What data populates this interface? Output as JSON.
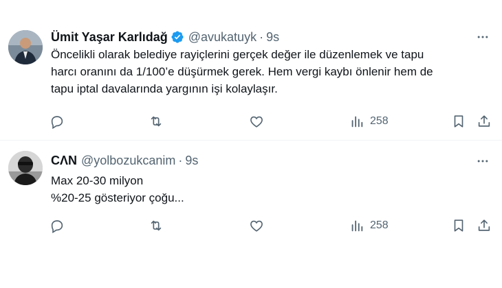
{
  "tweets": [
    {
      "author_name": "Ümit Yaşar Karlıdağ",
      "verified": true,
      "handle": "@avukatuyk",
      "separator": "·",
      "time": "9s",
      "text_lines": [
        "Öncelikli olarak belediye rayiçlerini gerçek değer ile düzenlemek ve tapu",
        "harcı oranını da 1/100’e düşürmek gerek. Hem vergi kaybı önlenir hem de",
        "tapu iptal davalarında yargının işi kolaylaşır."
      ],
      "views": "258"
    },
    {
      "author_name": "CΛN",
      "verified": false,
      "handle": "@yolbozukcanim",
      "separator": "·",
      "time": "9s",
      "text_lines": [
        "Max 20-30 milyon",
        "%20-25 gösteriyor çoğu..."
      ],
      "views": "258"
    }
  ],
  "colors": {
    "text": "#0f1419",
    "muted": "#536471",
    "verified": "#1d9bf0",
    "divider": "#eff3f4"
  },
  "icons": [
    "more-icon",
    "reply-icon",
    "retweet-icon",
    "like-icon",
    "views-icon",
    "bookmark-icon",
    "share-icon",
    "verified-badge-icon"
  ]
}
